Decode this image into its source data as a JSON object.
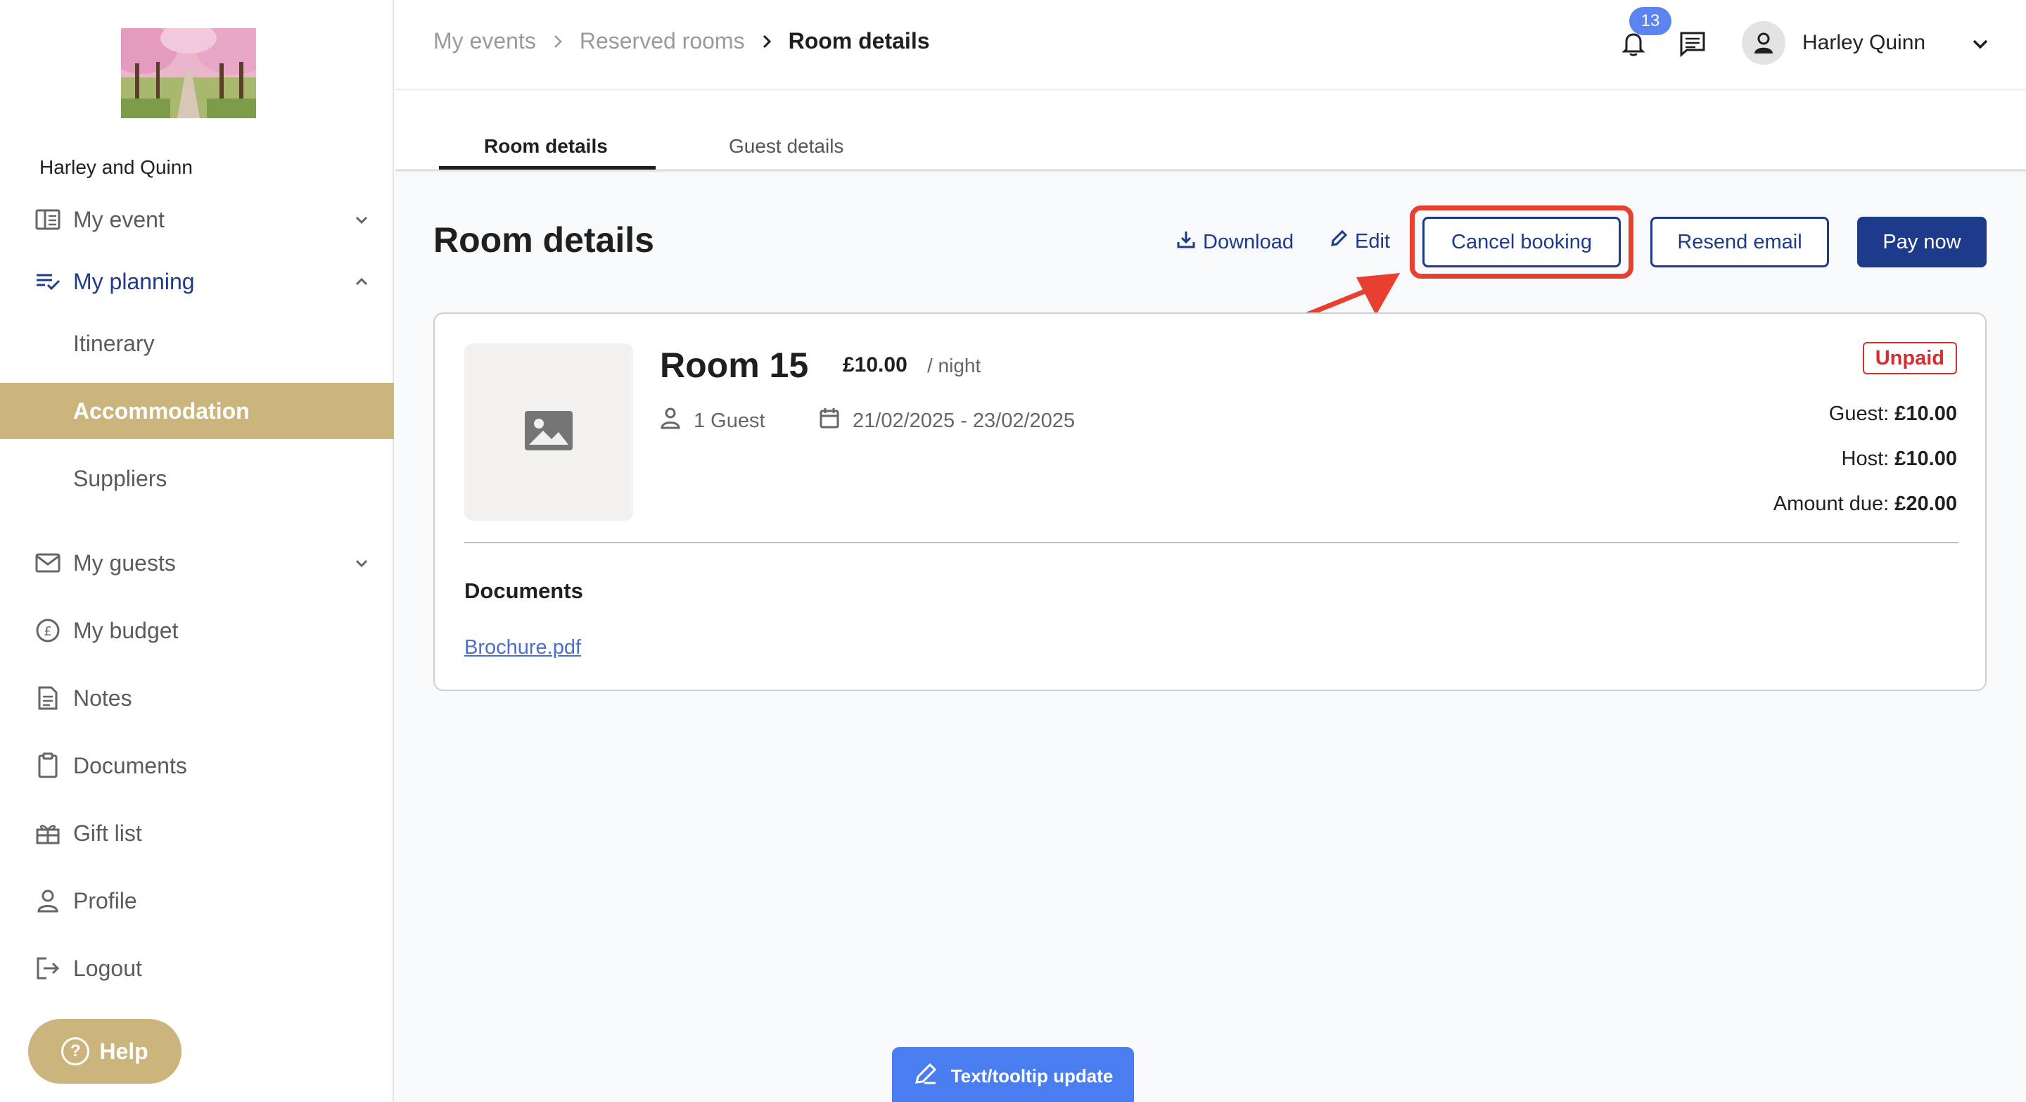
{
  "sidebar": {
    "event_name": "Harley and Quinn",
    "items": [
      {
        "label": "My event",
        "icon": "book-icon"
      },
      {
        "label": "My planning",
        "icon": "planning-list-icon"
      },
      {
        "label": "Itinerary"
      },
      {
        "label": "Accommodation"
      },
      {
        "label": "Suppliers"
      },
      {
        "label": "My guests",
        "icon": "mail-icon"
      },
      {
        "label": "My budget",
        "icon": "pound-coin-icon"
      },
      {
        "label": "Notes",
        "icon": "notes-icon"
      },
      {
        "label": "Documents",
        "icon": "clipboard-icon"
      },
      {
        "label": "Gift list",
        "icon": "gift-icon"
      },
      {
        "label": "Profile",
        "icon": "person-icon"
      },
      {
        "label": "Logout",
        "icon": "logout-icon"
      }
    ],
    "help_label": "Help"
  },
  "header": {
    "breadcrumb": [
      "My events",
      "Reserved rooms",
      "Room details"
    ],
    "notification_count": "13",
    "user_name": "Harley Quinn"
  },
  "tabs": [
    {
      "label": "Room details",
      "active": true
    },
    {
      "label": "Guest details",
      "active": false
    }
  ],
  "page": {
    "title": "Room details",
    "actions": {
      "download": "Download",
      "edit": "Edit",
      "cancel": "Cancel booking",
      "resend": "Resend email",
      "pay": "Pay now"
    }
  },
  "room": {
    "name": "Room 15",
    "price": "£10.00",
    "unit": "/ night",
    "guests": "1 Guest",
    "dates": "21/02/2025 - 23/02/2025",
    "status": "Unpaid",
    "guest_label": "Guest:",
    "guest_amount": "£10.00",
    "host_label": "Host:",
    "host_amount": "£10.00",
    "due_label": "Amount due:",
    "due_amount": "£20.00",
    "documents_title": "Documents",
    "documents": [
      "Brochure.pdf"
    ]
  },
  "floating": {
    "label": "Text/tooltip update"
  },
  "colors": {
    "accent_gold": "#ccb57c",
    "primary_navy": "#1e3a8a",
    "danger_red": "#d92d2d",
    "highlight_red": "#e8402e",
    "pill_blue": "#4a7ef0"
  }
}
